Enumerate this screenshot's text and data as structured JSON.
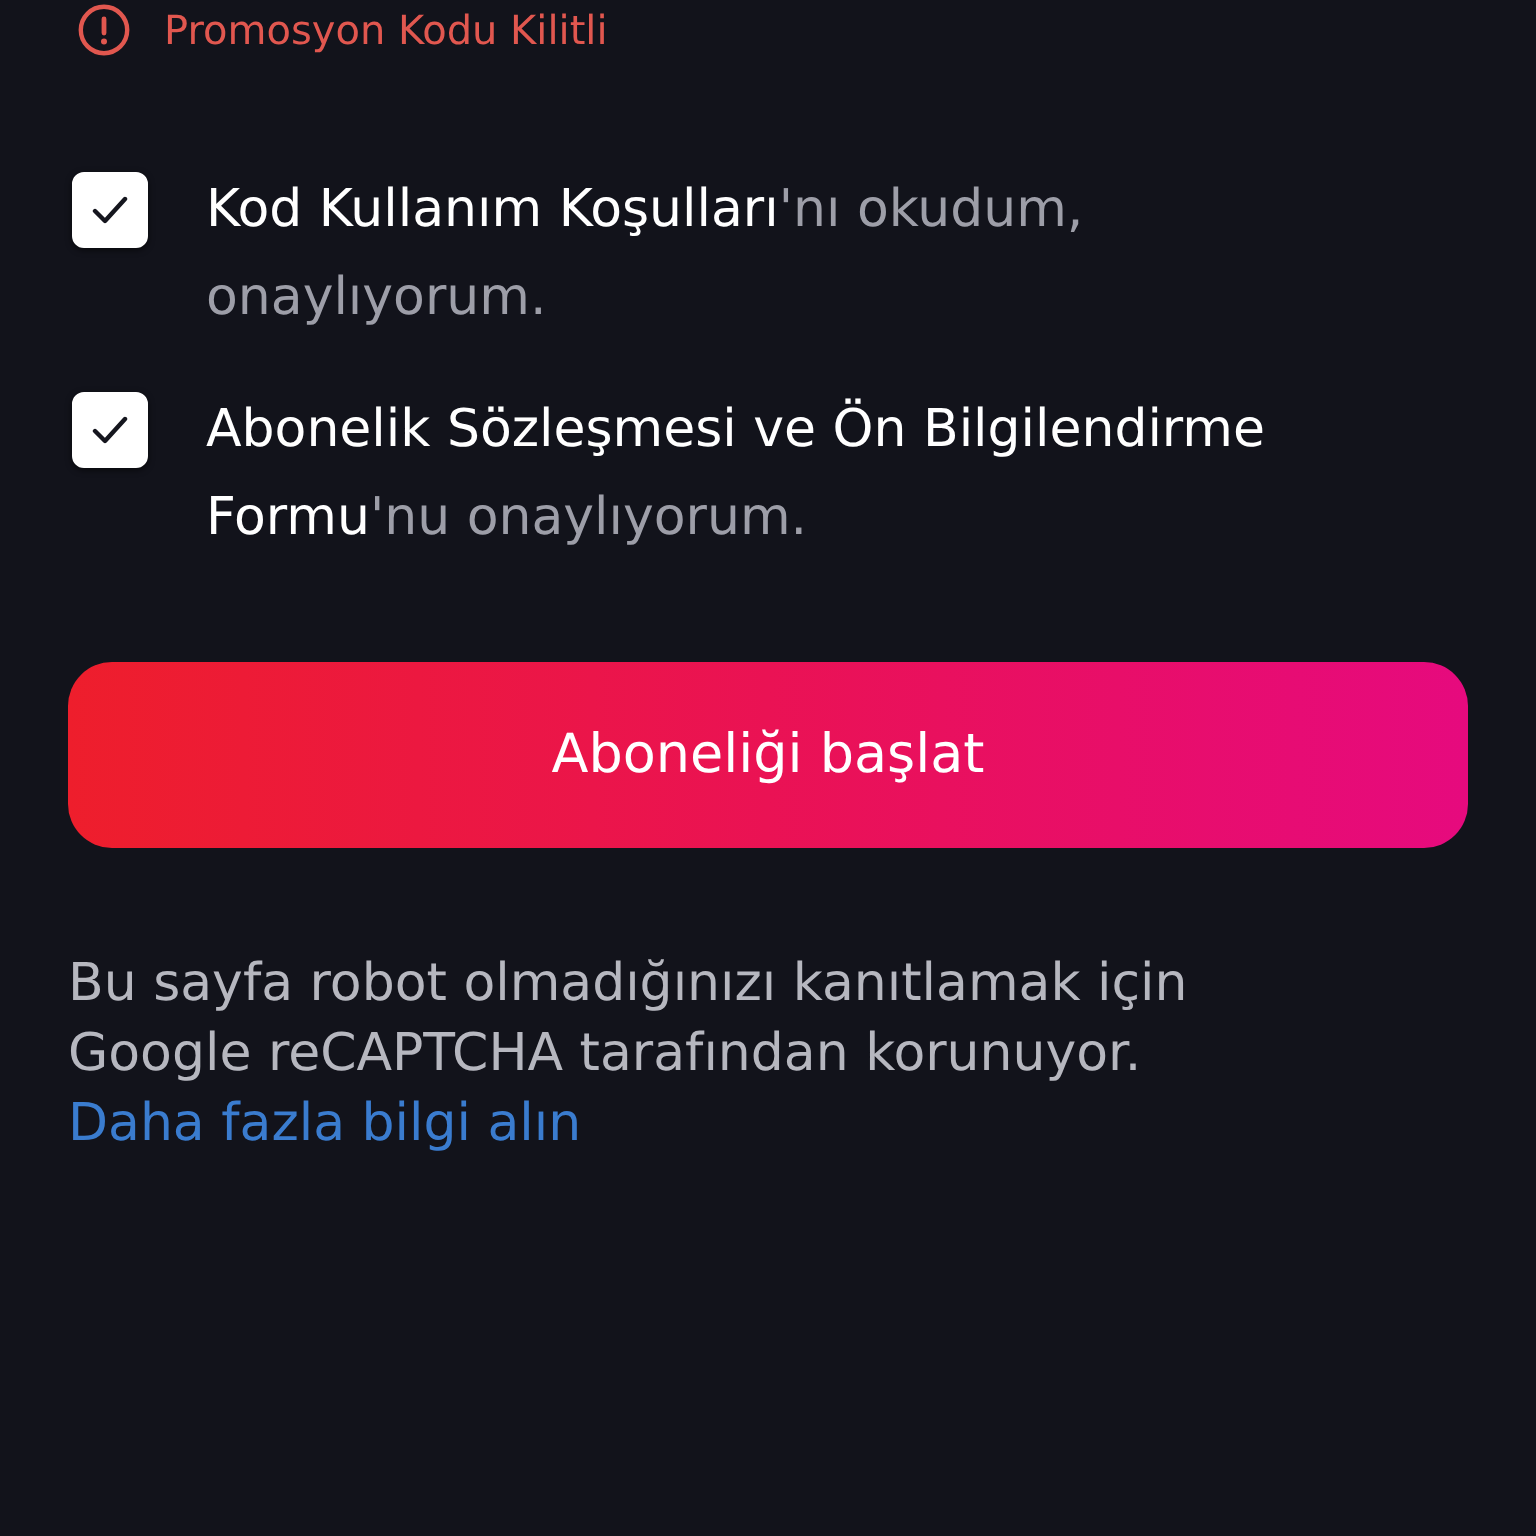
{
  "alert": {
    "text": "Promosyon Kodu Kilitli"
  },
  "agreements": [
    {
      "text": "**Kod Kullanım Koşulları**'nı okudum, onaylıyorum.",
      "checked": true
    },
    {
      "text": "**Abonelik Sözleşmesi ve Ön Bilgilendirme Formu**'nu onaylıyorum.",
      "checked": true
    }
  ],
  "submit_button": {
    "label": "Aboneliği başlat"
  },
  "notice": {
    "text": "Bu sayfa robot olmadığınızı kanıtlamak için Google reCAPTCHA tarafından korunuyor.",
    "link": "Daha fazla bilgi alın"
  }
}
